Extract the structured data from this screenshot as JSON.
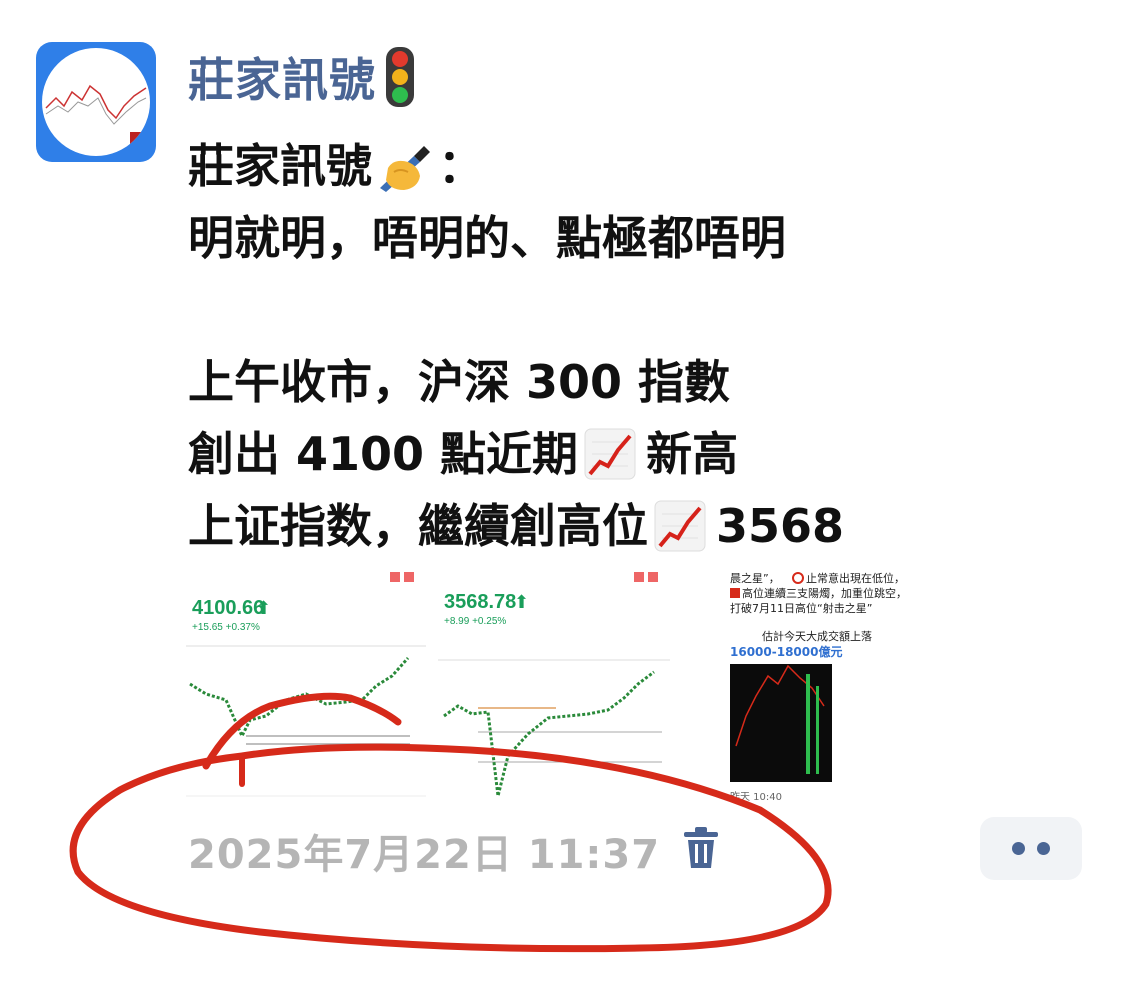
{
  "post": {
    "author": "莊家訊號",
    "message_lines": [
      "莊家訊號",
      "明就明，唔明的、點極都唔明",
      "",
      "上午收市，沪深 300 指數",
      "創出 4100 點近期",
      "新高",
      "上证指数，繼續創高位",
      "3568"
    ],
    "timestamp": "2025年7月22日 11:37",
    "colon": "："
  },
  "thumbnails": {
    "csi300_value": "4100.66",
    "csi300_change": "+15.65 +0.37%",
    "sse_value": "3568.78",
    "sse_change": "+8.99 +0.25%",
    "third_line1": "晨之星”，",
    "third_line2": "止常意出現在低位，",
    "third_line3": "高位連續三支陽燭，加重位跳空，",
    "third_line4": "打破7月11日高位“射击之星”",
    "third_line5": "估計今天大成交額上落",
    "third_line6": "16000-18000億元",
    "third_footer": "昨天 10:40"
  },
  "colors": {
    "name_blue": "#4a6594",
    "timestamp_grey": "#b5b5b5",
    "up_green": "#1a9e5a",
    "annotation_red": "#d62a1a"
  },
  "icons": [
    "traffic-light-icon",
    "writing-hand-icon",
    "chart-increasing-icon",
    "trash-icon",
    "more-dots-icon"
  ]
}
